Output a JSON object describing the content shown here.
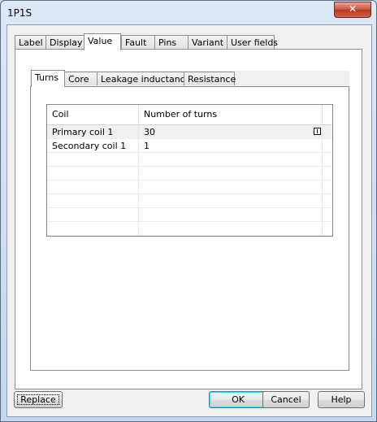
{
  "window": {
    "title": "1P1S",
    "close_glyph": "✕"
  },
  "outer_tabs": [
    {
      "label": "Label"
    },
    {
      "label": "Display"
    },
    {
      "label": "Value"
    },
    {
      "label": "Fault"
    },
    {
      "label": "Pins"
    },
    {
      "label": "Variant"
    },
    {
      "label": "User fields"
    }
  ],
  "outer_active": "Value",
  "inner_tabs": [
    {
      "label": "Turns"
    },
    {
      "label": "Core"
    },
    {
      "label": "Leakage inductance"
    },
    {
      "label": "Resistance"
    }
  ],
  "inner_active": "Turns",
  "grid": {
    "columns": [
      "Coil",
      "Number of turns"
    ],
    "rows": [
      {
        "coil": "Primary coil 1",
        "turns": "30"
      },
      {
        "coil": "Secondary coil 1",
        "turns": "1"
      }
    ]
  },
  "buttons": {
    "replace": "Replace",
    "ok": "OK",
    "cancel": "Cancel",
    "help": "Help"
  },
  "colors": {
    "default_button_border": "#3c7fb1",
    "close_button": "#c9503c"
  }
}
